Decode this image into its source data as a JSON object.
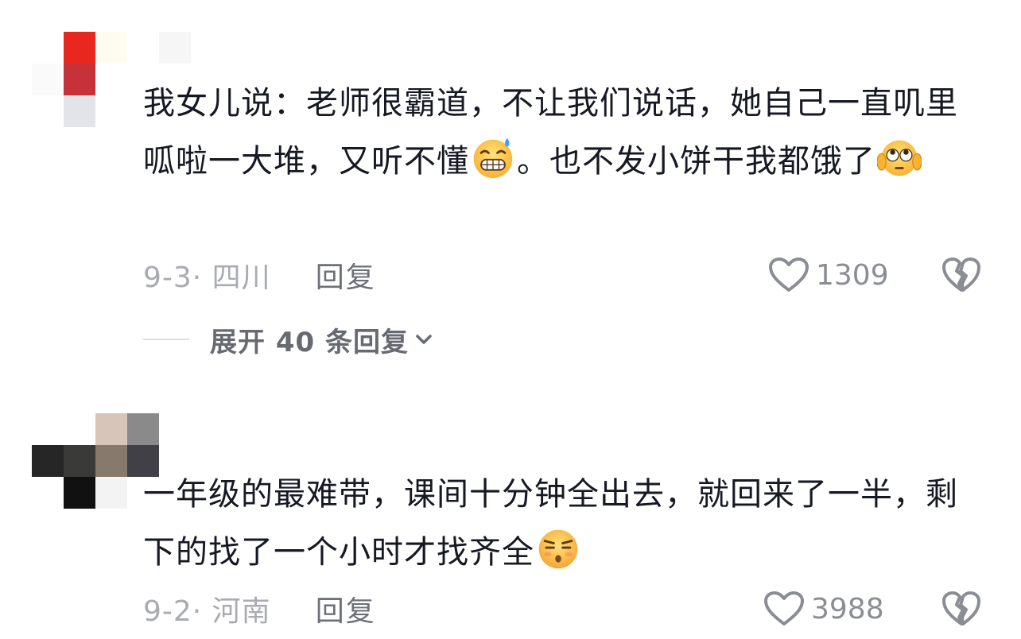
{
  "comments": [
    {
      "text_part1": "我女儿说：老师很霸道，不让我们说话，她自己一直叽里呱啦一大堆，又听不懂",
      "emoji1": "grimacing-sweat-emoji",
      "text_part2": "。也不发小饼干我都饿了",
      "emoji2": "eye-roll-hands-over-ears-emoji",
      "date_location": "9-3· 四川",
      "reply_label": "回复",
      "like_count": "1309",
      "expand_replies": "展开 40 条回复"
    },
    {
      "text_part1": "一年级的最难带，课间十分钟全出去，就回来了一半，剩下的找了一个小时才找齐全",
      "emoji1": "unamused-sigh-emoji",
      "date_location": "9-2· 河南",
      "reply_label": "回复",
      "like_count": "3988"
    }
  ],
  "icons": {
    "like": "heart-outline-icon",
    "dislike": "broken-heart-icon",
    "expand": "chevron-down-icon"
  },
  "colors": {
    "text": "#161823",
    "meta": "#a9abb0",
    "reply": "#6e7079",
    "icon": "#8b8d94"
  }
}
